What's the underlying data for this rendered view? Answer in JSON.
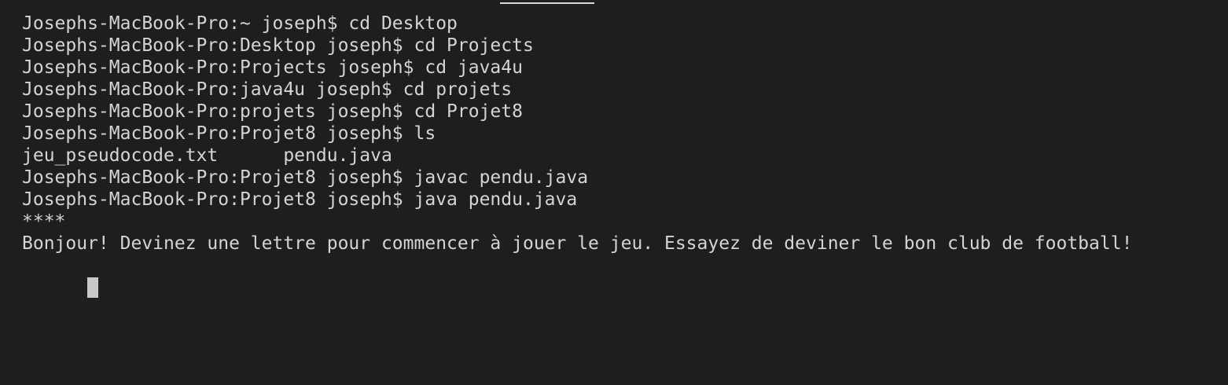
{
  "terminal": {
    "lines": [
      "Josephs-MacBook-Pro:~ joseph$ cd Desktop",
      "Josephs-MacBook-Pro:Desktop joseph$ cd Projects",
      "Josephs-MacBook-Pro:Projects joseph$ cd java4u",
      "Josephs-MacBook-Pro:java4u joseph$ cd projets",
      "Josephs-MacBook-Pro:projets joseph$ cd Projet8",
      "Josephs-MacBook-Pro:Projet8 joseph$ ls",
      "jeu_pseudocode.txt      pendu.java",
      "Josephs-MacBook-Pro:Projet8 joseph$ javac pendu.java",
      "Josephs-MacBook-Pro:Projet8 joseph$ java pendu.java",
      "****",
      "Bonjour! Devinez une lettre pour commencer à jouer le jeu. Essayez de deviner le bon club de football!"
    ],
    "input_value": ""
  },
  "colors": {
    "background": "#1e1e1e",
    "foreground": "#d4d4d4",
    "cursor": "#c8c8c8"
  }
}
